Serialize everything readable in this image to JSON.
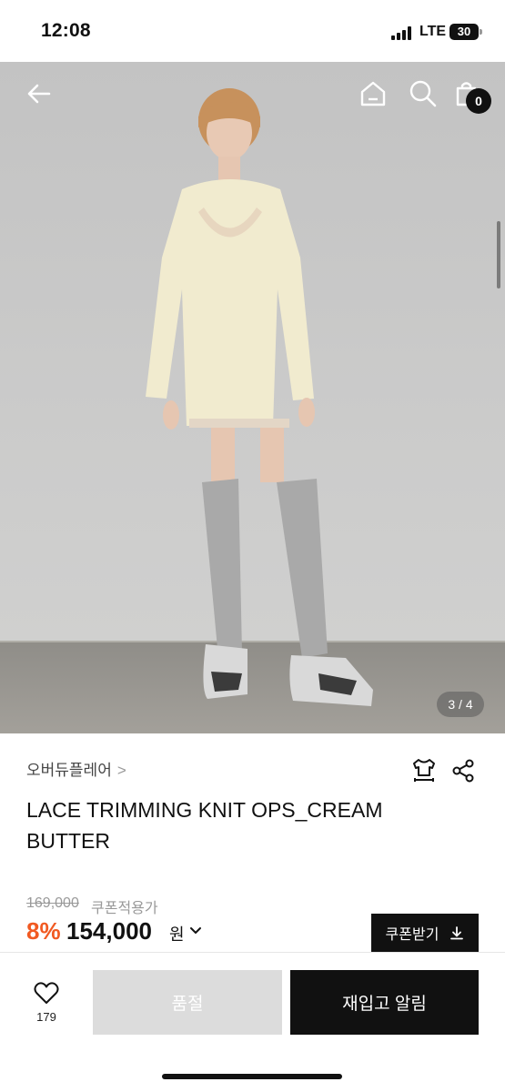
{
  "status_bar": {
    "time": "12:08",
    "network": "LTE",
    "battery": "30"
  },
  "header": {
    "icons": [
      "back-arrow-icon",
      "home-icon",
      "search-icon",
      "shopping-bag-icon"
    ],
    "cart_count": "0"
  },
  "gallery": {
    "counter": "3 / 4"
  },
  "product": {
    "brand": "오버듀플레어",
    "brand_chevron": ">",
    "title": "LACE TRIMMING KNIT OPS_CREAM BUTTER",
    "original_price": "169,000",
    "coupon_note": "쿠폰적용가",
    "discount": "8%",
    "price": "154,000",
    "currency": "원",
    "coupon_button": "쿠폰받기"
  },
  "bottom_bar": {
    "like_count": "179",
    "soldout_label": "품절",
    "restock_label": "재입고 알림"
  },
  "colors": {
    "discount": "#f15a22",
    "primary": "#111111",
    "disabled": "#dcdcdc"
  }
}
